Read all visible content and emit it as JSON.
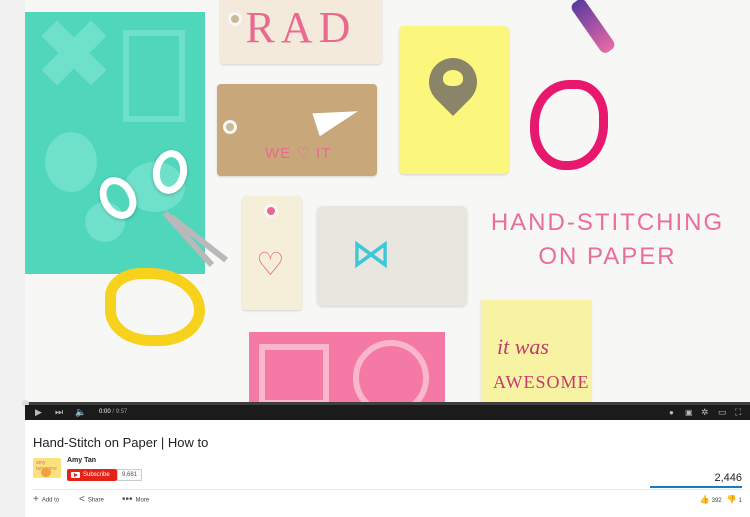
{
  "video": {
    "overlay_line1": "HAND-STITCHING",
    "overlay_line2": "ON PAPER",
    "tag_rad_text": "RAD",
    "tag_kraft_text": "WE ♡ IT",
    "note_line1": "it was",
    "note_line2": "AWESOME"
  },
  "controls": {
    "current_time": "0:00",
    "total_time": "/ 9:57",
    "progress_fraction": 0.0
  },
  "info": {
    "title": "Hand-Stitch on Paper | How to",
    "channel_name": "Amy Tan",
    "avatar_text": "amy tangerine",
    "subscribe_label": "Subscribe",
    "subscriber_count": "9,681",
    "view_count": "2,446",
    "actions": {
      "add_to": "Add to",
      "share": "Share",
      "more": "More"
    },
    "likes": "392",
    "dislikes": "1"
  },
  "icons": {
    "play": "play-icon",
    "next": "next-icon",
    "volume": "volume-icon",
    "settings": "gear-icon",
    "captions": "captions-icon",
    "theater": "theater-icon",
    "fullscreen": "fullscreen-icon"
  },
  "colors": {
    "brand_red": "#e62117",
    "accent_pink": "#ea6e9c",
    "progress_red": "#cc181e",
    "view_bar_blue": "#167ac6"
  }
}
